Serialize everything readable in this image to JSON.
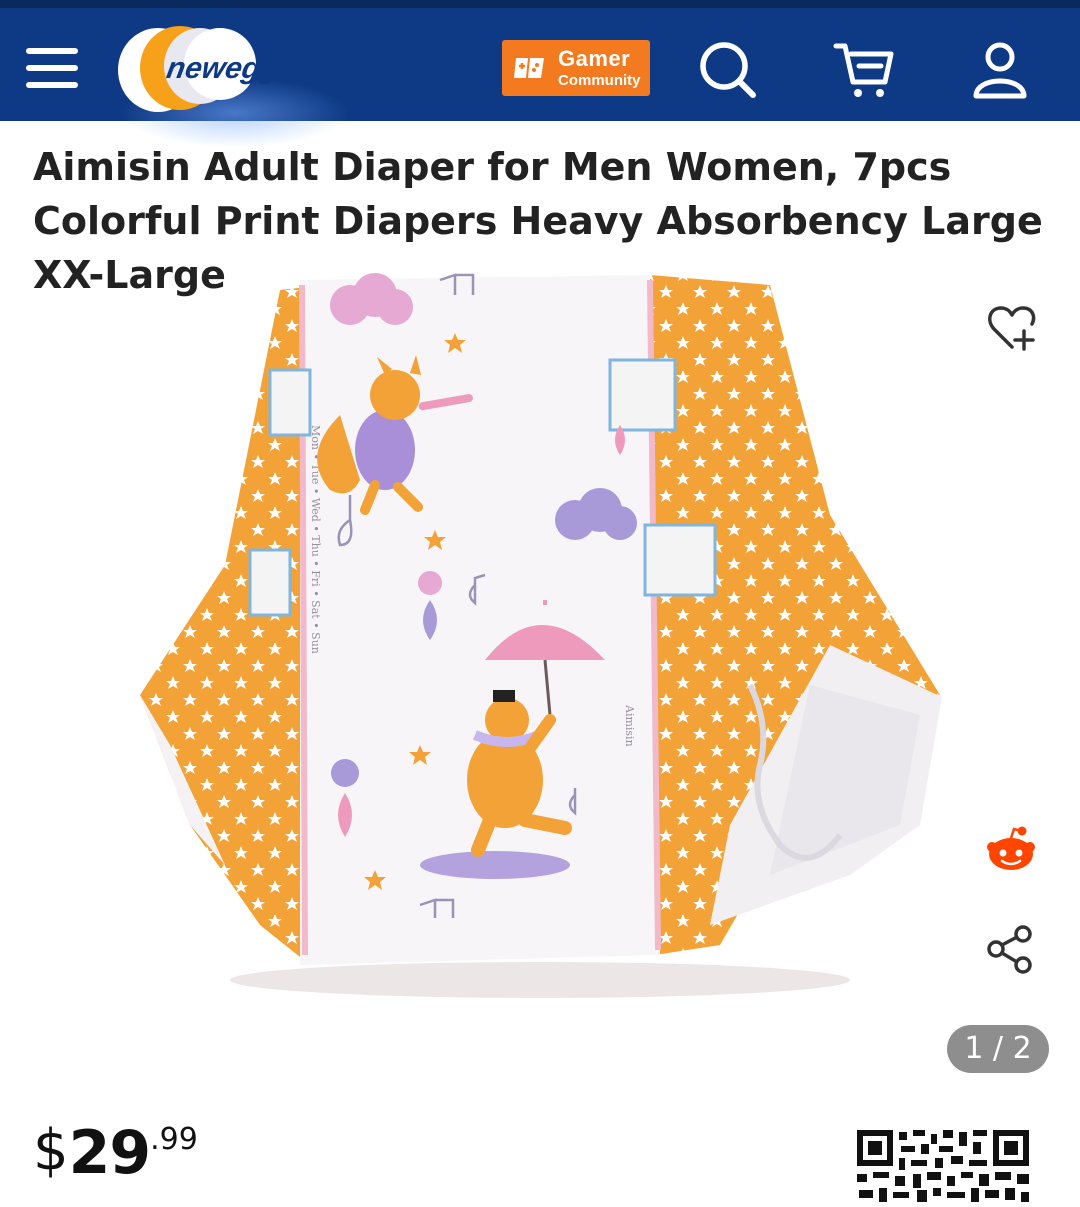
{
  "header": {
    "logo_text": "newegg",
    "gamer_title": "Gamer",
    "gamer_subtitle": "Community",
    "icons": [
      "menu-icon",
      "search-icon",
      "cart-icon",
      "account-icon"
    ],
    "colors": {
      "nav": "#0e3a85",
      "accent": "#f47a20"
    }
  },
  "product": {
    "title": "Aimisin Adult Diaper for Men Women, 7pcs Colorful Print Diapers Heavy Absorbency Large XX-Large",
    "image_counter": "1 / 2",
    "side_actions": [
      "wishlist-icon",
      "reddit-icon",
      "share-icon"
    ]
  },
  "price": {
    "currency": "$",
    "whole": "29",
    "cents": ".99"
  },
  "diaper_print": {
    "left_tape_text": "Mon • Tue • Wed • Thu • Fri • Sat • Sun",
    "right_tape_text": "Aimisin"
  }
}
